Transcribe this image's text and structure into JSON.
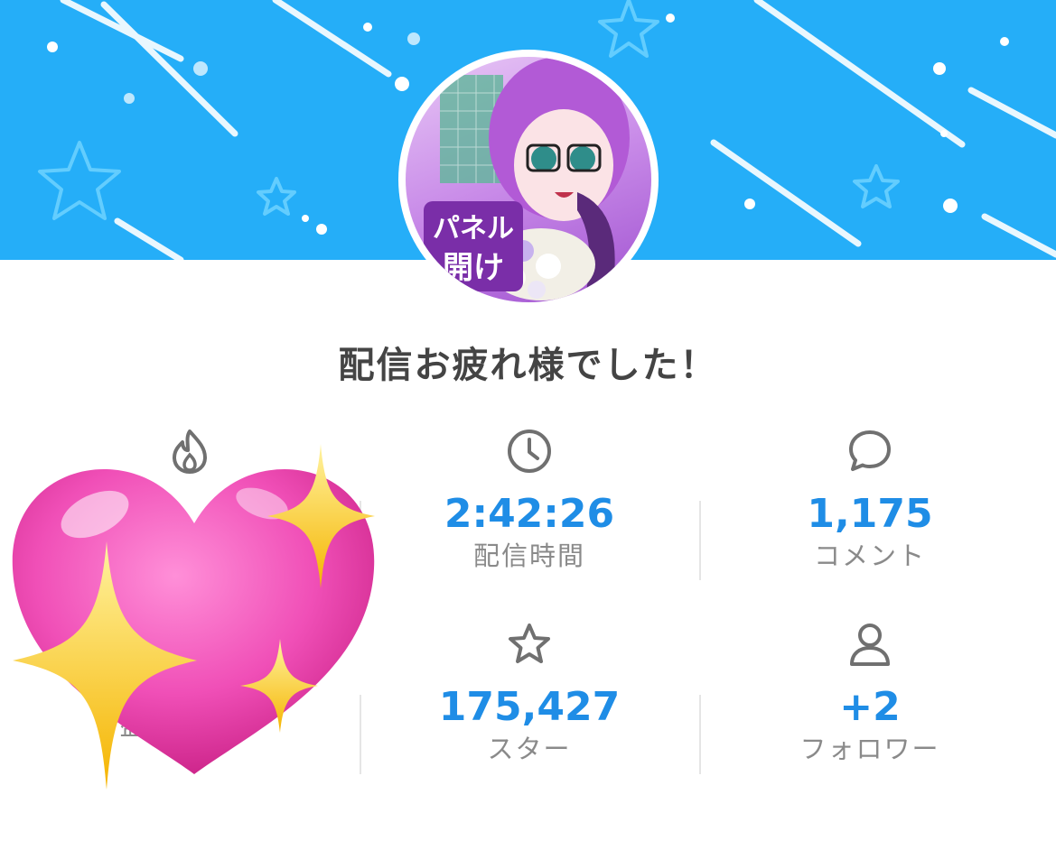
{
  "header": {
    "title": "配信お疲れ様でした！",
    "avatar_text": "パネル開け"
  },
  "stats": [
    {
      "icon": "fire-icon",
      "value": "",
      "label": "盛り上がり"
    },
    {
      "icon": "clock-icon",
      "value": "2:42:26",
      "label": "配信時間"
    },
    {
      "icon": "comment-icon",
      "value": "1,175",
      "label": "コメント"
    },
    {
      "icon": "heart-sticker",
      "value": "",
      "label": ""
    },
    {
      "icon": "star-icon",
      "value": "175,427",
      "label": "スター"
    },
    {
      "icon": "person-icon",
      "value": "+2",
      "label": "フォロワー"
    }
  ],
  "colors": {
    "banner": "#25aef8",
    "value": "#1f8de6",
    "label": "#8a8a8a",
    "title": "#444444",
    "icon": "#707070"
  }
}
